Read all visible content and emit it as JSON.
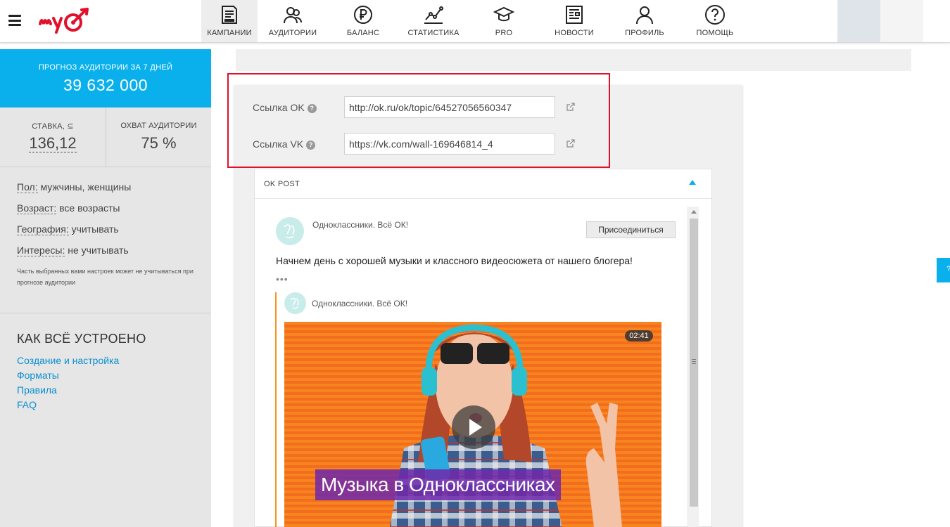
{
  "header": {
    "nav": [
      {
        "label": "КАМПАНИИ",
        "icon": "campaigns-icon",
        "active": true
      },
      {
        "label": "АУДИТОРИИ",
        "icon": "audiences-icon"
      },
      {
        "label": "БАЛАНС",
        "icon": "ruble-icon"
      },
      {
        "label": "СТАТИСТИКА",
        "icon": "statistics-icon"
      },
      {
        "label": "PRO",
        "icon": "graduation-cap-icon"
      },
      {
        "label": "НОВОСТИ",
        "icon": "newspaper-icon"
      },
      {
        "label": "ПРОФИЛЬ",
        "icon": "profile-icon"
      },
      {
        "label": "ПОМОЩЬ",
        "icon": "help-icon"
      }
    ]
  },
  "sidebar": {
    "forecast_label": "ПРОГНОЗ АУДИТОРИИ ЗА 7 ДНЕЙ",
    "forecast_value": "39 632 000",
    "rate_label": "СТАВКА, ⊆",
    "rate_value": "136,12",
    "reach_label": "ОХВАТ АУДИТОРИИ",
    "reach_value": "75 %",
    "targeting": [
      {
        "key": "Пол:",
        "value": "мужчины, женщины"
      },
      {
        "key": "Возраст:",
        "value": "все возрасты"
      },
      {
        "key": "География:",
        "value": "учитывать"
      },
      {
        "key": "Интересы:",
        "value": "не учитывать"
      }
    ],
    "note": "Часть выбранных вами настроек может не учитываться при прогнозе аудитории",
    "howto_title": "КАК ВСЁ УСТРОЕНО",
    "links": [
      "Создание и настройка",
      "Форматы",
      "Правила",
      "FAQ"
    ]
  },
  "form": {
    "ok_label": "Ссылка OK",
    "ok_value": "http://ok.ru/ok/topic/64527056560347",
    "vk_label": "Ссылка VK",
    "vk_value": "https://vk.com/wall-169646814_4"
  },
  "ok_post": {
    "title": "OK POST",
    "group_name": "Одноклассники. Всё ОК!",
    "join_label": "Присоединиться",
    "text": "Начнем день с хорошей музыки и классного видеосюжета от нашего блогера!",
    "more": "•••",
    "repost_group_name": "Одноклассники. Всё ОК!",
    "video_duration": "02:41",
    "video_caption": "Музыка в Одноклассниках"
  },
  "side_tab_label": "?",
  "colors": {
    "accent": "#0ab0ec",
    "highlight": "#e3102b",
    "logo": "#e3102b",
    "ok_orange": "#f7931e"
  }
}
